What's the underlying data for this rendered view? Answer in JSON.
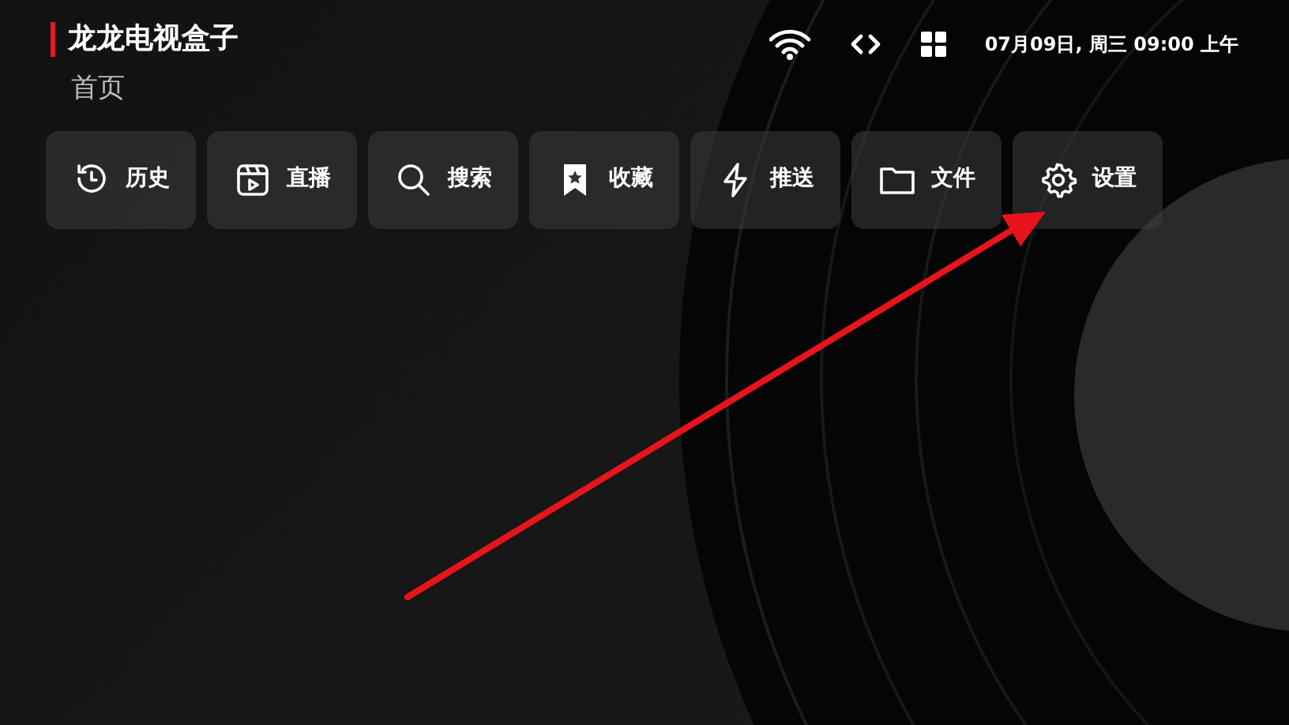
{
  "app_title": "龙龙电视盒子",
  "page_title": "首页",
  "status": {
    "datetime": "07月09日, 周三 09:00 上午"
  },
  "menu": [
    {
      "kind": "history",
      "label": "历史"
    },
    {
      "kind": "live",
      "label": "直播"
    },
    {
      "kind": "search",
      "label": "搜索"
    },
    {
      "kind": "favorite",
      "label": "收藏"
    },
    {
      "kind": "push",
      "label": "推送"
    },
    {
      "kind": "file",
      "label": "文件"
    },
    {
      "kind": "settings",
      "label": "设置"
    }
  ]
}
